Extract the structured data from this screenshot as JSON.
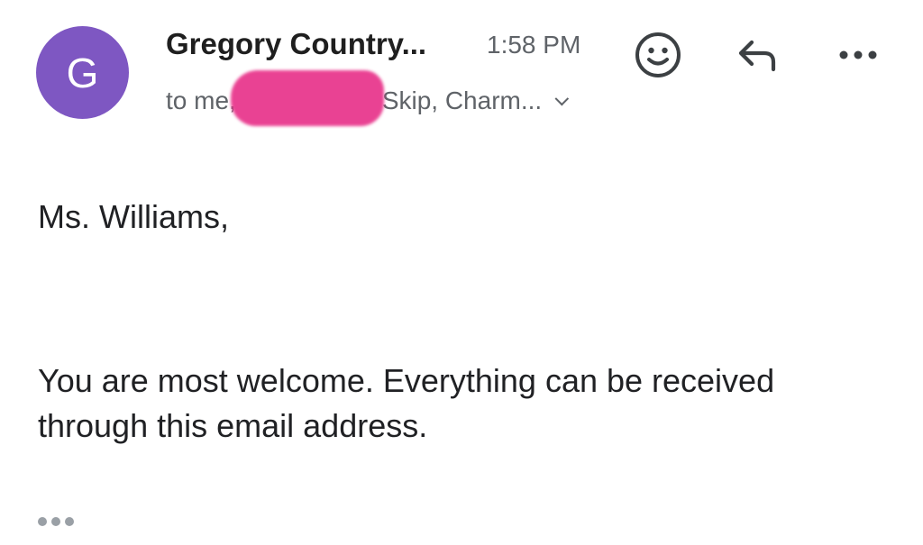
{
  "avatar": {
    "letter": "G",
    "color": "#7e57c2"
  },
  "header": {
    "sender": "Gregory Country...",
    "time": "1:58 PM",
    "recipients_prefix": "to me,",
    "recipients_suffix": "Skip, Charm..."
  },
  "actions": {
    "emoji_icon": "emoji-smile-icon",
    "reply_icon": "reply-icon",
    "more_icon": "more-horizontal-icon"
  },
  "body": {
    "greeting": "Ms. Williams,",
    "paragraph": "You are most welcome. Everything can be received through this email address."
  },
  "colors": {
    "redaction": "#e8338a",
    "secondary_text": "#5f6368"
  }
}
